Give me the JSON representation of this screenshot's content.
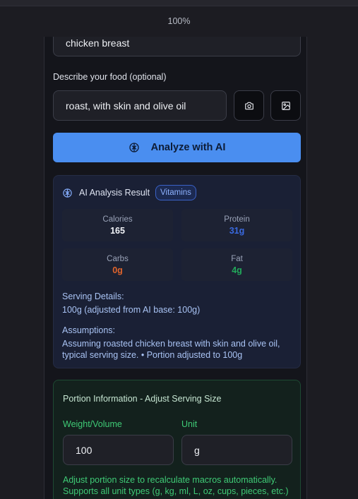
{
  "zoom": "100%",
  "form": {
    "food_value": "chicken breast",
    "describe_label": "Describe your food (optional)",
    "describe_value": "roast, with skin and olive oil",
    "analyze_label": "Analyze with AI"
  },
  "result": {
    "title": "AI Analysis Result",
    "badge": "Vitamins",
    "stats": {
      "calories_label": "Calories",
      "calories_value": "165",
      "protein_label": "Protein",
      "protein_value": "31g",
      "carbs_label": "Carbs",
      "carbs_value": "0g",
      "fat_label": "Fat",
      "fat_value": "4g"
    },
    "serving_title": "Serving Details:",
    "serving_text": "100g (adjusted from AI base: 100g)",
    "assumptions_title": "Assumptions:",
    "assumptions_text": "Assuming roasted chicken breast with skin and olive oil, typical serving size. • Portion adjusted to 100g"
  },
  "portion": {
    "title": "Portion Information - Adjust Serving Size",
    "weight_label": "Weight/Volume",
    "weight_value": "100",
    "unit_label": "Unit",
    "unit_value": "g",
    "help": "Adjust portion size to recalculate macros automatically. Supports all unit types (g, kg, ml, L, oz, cups, pieces, etc.)"
  },
  "colors": {
    "accent": "#4a8ef0",
    "protein": "#3a6ae0",
    "carbs": "#e0642c",
    "fat": "#22a85a"
  },
  "icons": {
    "camera": "camera-icon",
    "image": "image-icon",
    "brain": "brain-icon"
  }
}
